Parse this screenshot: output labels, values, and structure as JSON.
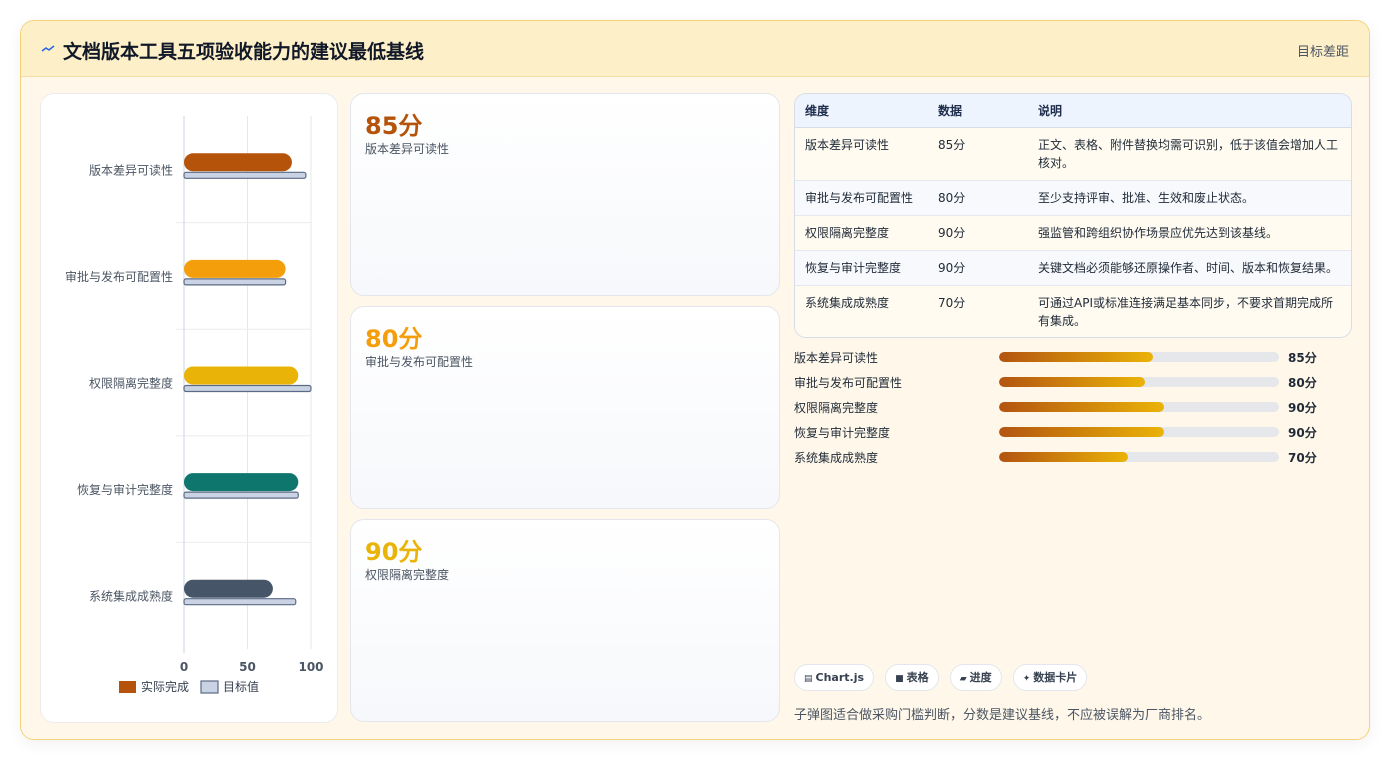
{
  "header": {
    "title": "文档版本工具五项验收能力的建议最低基线",
    "link": "目标差距",
    "icon": "sparkle-icon"
  },
  "chart_data": {
    "type": "bar",
    "orientation": "horizontal",
    "categories": [
      "版本差异可读性",
      "审批与发布可配置性",
      "权限隔离完整度",
      "恢复与审计完整度",
      "系统集成成熟度"
    ],
    "series": [
      {
        "name": "实际完成",
        "values": [
          85,
          80,
          90,
          90,
          70
        ],
        "colors": [
          "#b45309",
          "#f59e0b",
          "#eab308",
          "#0f766e",
          "#475569"
        ]
      },
      {
        "name": "目标值",
        "values": [
          96,
          80,
          100,
          90,
          88
        ],
        "color": "#c9d3e3"
      }
    ],
    "xlim": [
      0,
      100
    ],
    "xticks": [
      0,
      50,
      100
    ],
    "grid": true,
    "legend": "bottom"
  },
  "metrics": [
    {
      "value": "85分",
      "label": "版本差异可读性",
      "color": "#b45309"
    },
    {
      "value": "80分",
      "label": "审批与发布可配置性",
      "color": "#f59e0b"
    },
    {
      "value": "90分",
      "label": "权限隔离完整度",
      "color": "#eab308"
    }
  ],
  "table": {
    "headers": [
      "维度",
      "数据",
      "说明"
    ],
    "rows": [
      [
        "版本差异可读性",
        "85分",
        "正文、表格、附件替换均需可识别，低于该值会增加人工核对。"
      ],
      [
        "审批与发布可配置性",
        "80分",
        "至少支持评审、批准、生效和废止状态。"
      ],
      [
        "权限隔离完整度",
        "90分",
        "强监管和跨组织协作场景应优先达到该基线。"
      ],
      [
        "恢复与审计完整度",
        "90分",
        "关键文档必须能够还原操作者、时间、版本和恢复结果。"
      ],
      [
        "系统集成成熟度",
        "70分",
        "可通过API或标准连接满足基本同步，不要求首期完成所有集成。"
      ]
    ]
  },
  "progress": [
    {
      "name": "版本差异可读性",
      "value": "85分",
      "fraction": 0.55
    },
    {
      "name": "审批与发布可配置性",
      "value": "80分",
      "fraction": 0.52
    },
    {
      "name": "权限隔离完整度",
      "value": "90分",
      "fraction": 0.59
    },
    {
      "name": "恢复与审计完整度",
      "value": "90分",
      "fraction": 0.59
    },
    {
      "name": "系统集成成熟度",
      "value": "70分",
      "fraction": 0.46
    }
  ],
  "tags": [
    {
      "icon": "▤",
      "label": "Chart.js"
    },
    {
      "icon": "■",
      "label": "表格"
    },
    {
      "icon": "▰",
      "label": "进度"
    },
    {
      "icon": "✦",
      "label": "数据卡片"
    }
  ],
  "footnote": "子弹图适合做采购门槛判断，分数是建议基线，不应被误解为厂商排名。"
}
